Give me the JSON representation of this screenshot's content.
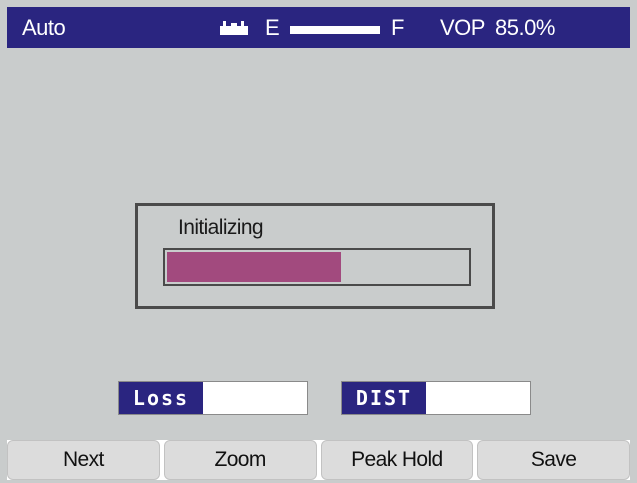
{
  "status_bar": {
    "mode": "Auto",
    "battery_icon": "battery-icon",
    "gauge": {
      "empty_label": "E",
      "full_label": "F",
      "level": 1.0
    },
    "vop_label": "VOP",
    "vop_value": "85.0%"
  },
  "dialog": {
    "title": "Initializing",
    "progress": 0.58,
    "progress_color": "#a24a7e"
  },
  "readouts": {
    "loss": {
      "label": "Loss",
      "value": ""
    },
    "dist": {
      "label": "DIST",
      "value": ""
    }
  },
  "softkeys": [
    {
      "label": "Next"
    },
    {
      "label": "Zoom"
    },
    {
      "label": "Peak Hold"
    },
    {
      "label": "Save"
    }
  ],
  "colors": {
    "header_bg": "#2a2580",
    "screen_bg": "#c9cccc",
    "tag_bg": "#2a2580"
  }
}
